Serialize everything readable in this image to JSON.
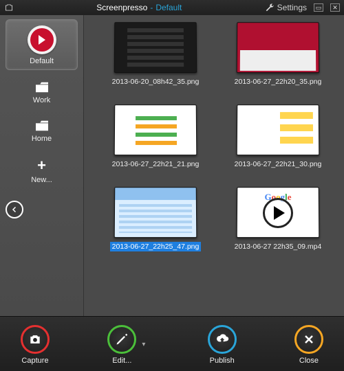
{
  "titlebar": {
    "appname": "Screenpresso",
    "separator": "-",
    "workspace": "Default",
    "settings_label": "Settings"
  },
  "sidebar": {
    "items": [
      {
        "label": "Default"
      },
      {
        "label": "Work"
      },
      {
        "label": "Home"
      },
      {
        "label": "New..."
      }
    ]
  },
  "gallery": {
    "items": [
      {
        "filename": "2013-06-20_08h42_35.png"
      },
      {
        "filename": "2013-06-27_22h20_35.png"
      },
      {
        "filename": "2013-06-27_22h21_21.png"
      },
      {
        "filename": "2013-06-27_22h21_30.png"
      },
      {
        "filename": "2013-06-27_22h25_47.png"
      },
      {
        "filename": "2013-06-27 22h35_09.mp4"
      }
    ],
    "selected_index": 4
  },
  "toolbar": {
    "capture": "Capture",
    "edit": "Edit...",
    "publish": "Publish",
    "close": "Close"
  }
}
